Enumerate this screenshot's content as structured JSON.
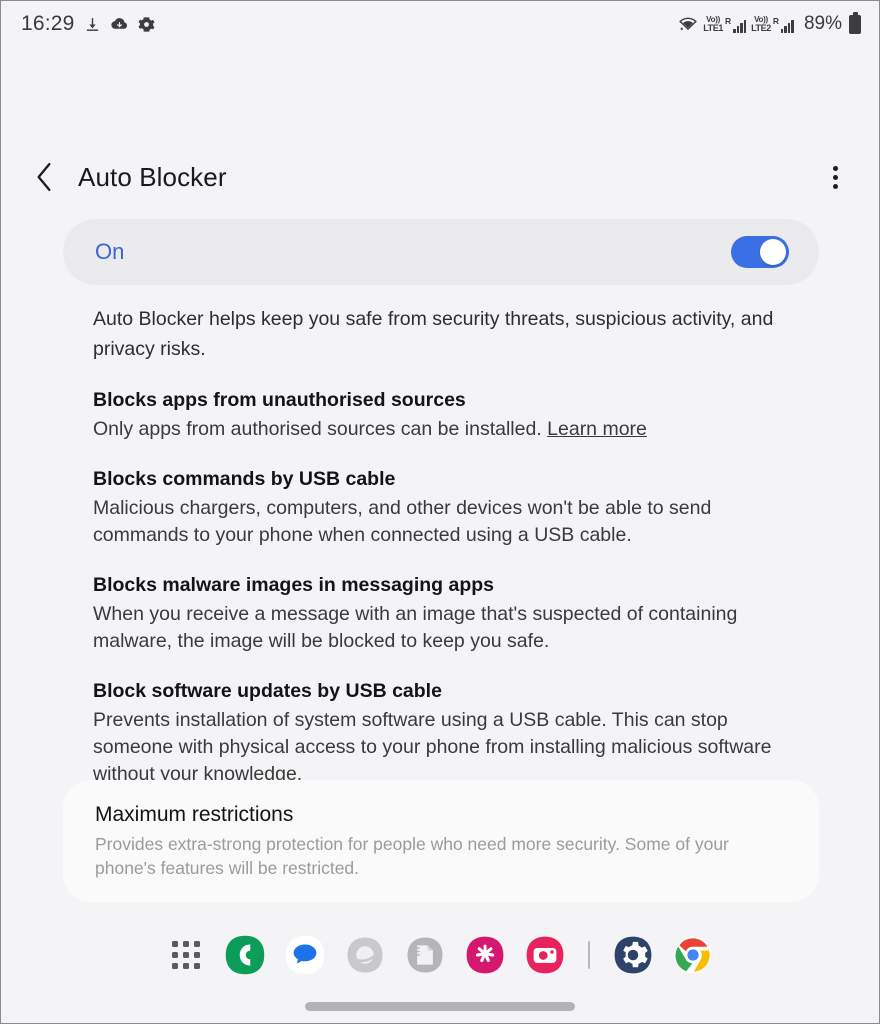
{
  "statusbar": {
    "time": "16:29",
    "left_icons": [
      "download-icon",
      "cloud-download-icon",
      "gear-icon"
    ],
    "sim1": {
      "volte": "Vo))",
      "network": "LTE1",
      "roaming": "R"
    },
    "sim2": {
      "volte": "Vo))",
      "network": "LTE2",
      "roaming": "R"
    },
    "wifi_icon": "wifi-icon",
    "battery_percent": "89%"
  },
  "appbar": {
    "back_icon": "back-chevron-icon",
    "title": "Auto Blocker",
    "more_icon": "more-options-icon"
  },
  "master_toggle": {
    "label": "On",
    "state": "on"
  },
  "intro": "Auto Blocker helps keep you safe from security threats, suspicious activity, and privacy risks.",
  "sections": [
    {
      "title": "Blocks apps from unauthorised sources",
      "desc": "Only apps from authorised sources can be installed. ",
      "link": "Learn more"
    },
    {
      "title": "Blocks commands by USB cable",
      "desc": "Malicious chargers, computers, and other devices won't be able to send commands to your phone when connected using a USB cable.",
      "link": ""
    },
    {
      "title": "Blocks malware images in messaging apps",
      "desc": "When you receive a message with an image that's suspected of containing malware, the image will be blocked to keep you safe.",
      "link": ""
    },
    {
      "title": "Block software updates by USB cable",
      "desc": "Prevents installation of system software using a USB cable. This can stop someone with physical access to your phone from installing malicious software without your knowledge.",
      "link": ""
    }
  ],
  "max_restrictions": {
    "title": "Maximum restrictions",
    "desc": "Provides extra-strong protection for people who need more security. Some of your phone's features will be restricted."
  },
  "taskbar": {
    "apps_button": "apps-grid-icon",
    "items": [
      {
        "name": "phone-app-icon",
        "label": "Phone",
        "color": "#0c9d58"
      },
      {
        "name": "messages-app-icon",
        "label": "Messages",
        "color": "#1a73e8"
      },
      {
        "name": "internet-app-icon",
        "label": "Internet",
        "color": "#c4c4c7"
      },
      {
        "name": "notes-app-icon",
        "label": "Samsung Notes",
        "color": "#b9b9bc"
      },
      {
        "name": "gallery-app-icon",
        "label": "Gallery",
        "color": "#d6176f"
      },
      {
        "name": "camera-app-icon",
        "label": "Camera",
        "color": "#e8225c"
      },
      {
        "name": "settings-app-icon",
        "label": "Settings",
        "color": "#2e4369"
      },
      {
        "name": "chrome-app-icon",
        "label": "Chrome",
        "color": "#4285f4"
      }
    ]
  },
  "colors": {
    "page_background": "#f4f4f6",
    "accent_blue": "#3b6fe4",
    "card_background": "#fafafa",
    "toggle_card_background": "#ebebed"
  }
}
